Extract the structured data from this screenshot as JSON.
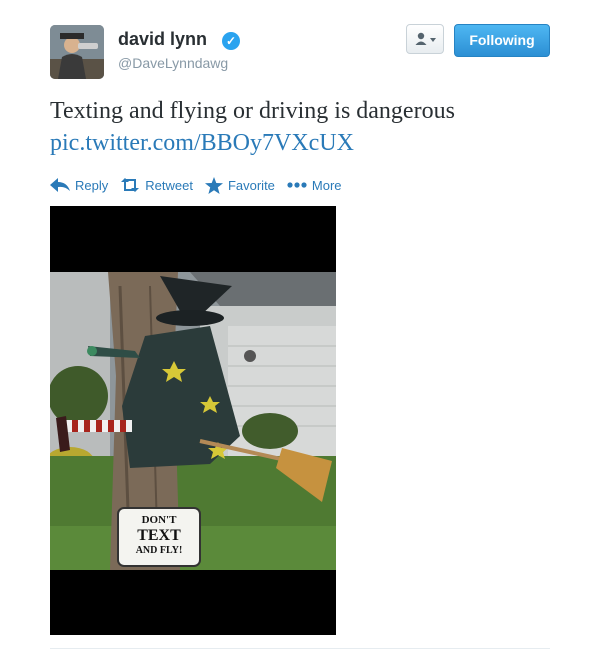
{
  "user": {
    "name": "david lynn",
    "handle": "@DaveLynndawg",
    "verified": true
  },
  "buttons": {
    "following_label": "Following"
  },
  "tweet": {
    "text": "Texting and flying or driving is dangerous",
    "link": "pic.twitter.com/BBOy7VXcUX"
  },
  "actions": [
    {
      "label": "Reply",
      "icon": "reply-icon"
    },
    {
      "label": "Retweet",
      "icon": "retweet-icon"
    },
    {
      "label": "Favorite",
      "icon": "star-icon"
    },
    {
      "label": "More",
      "icon": "ellipsis-icon"
    }
  ],
  "photo": {
    "sign_lines": [
      "DON'T",
      "TEXT",
      "AND FLY!"
    ]
  },
  "colors": {
    "accent": "#2a7ab8",
    "verified": "#2aa3ef",
    "following_button": "#2c8fd4"
  }
}
